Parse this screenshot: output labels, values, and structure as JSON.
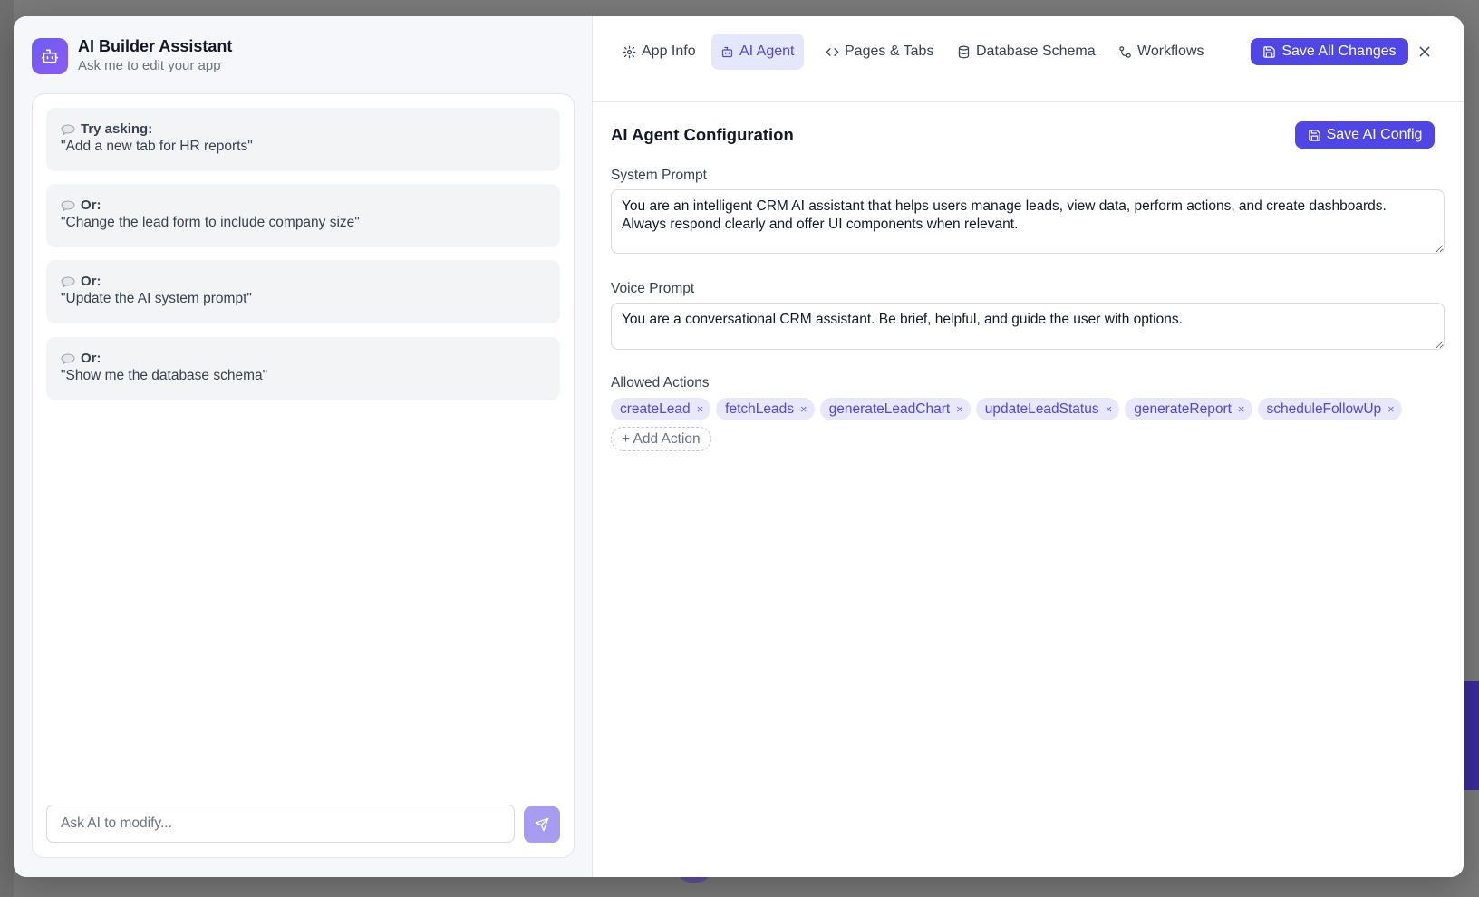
{
  "assistant": {
    "title": "AI Builder Assistant",
    "subtitle": "Ask me to edit your app"
  },
  "suggestions": [
    {
      "heading": "Try asking:",
      "text": "\"Add a new tab for HR reports\""
    },
    {
      "heading": "Or:",
      "text": "\"Change the lead form to include company size\""
    },
    {
      "heading": "Or:",
      "text": "\"Update the AI system prompt\""
    },
    {
      "heading": "Or:",
      "text": "\"Show me the database schema\""
    }
  ],
  "chat": {
    "placeholder": "Ask AI to modify..."
  },
  "tabs": [
    {
      "label": "App Info",
      "icon": "gear-icon"
    },
    {
      "label": "AI Agent",
      "icon": "bot-icon",
      "active": true
    },
    {
      "label": "Pages & Tabs",
      "icon": "code-icon"
    },
    {
      "label": "Database Schema",
      "icon": "database-icon"
    },
    {
      "label": "Workflows",
      "icon": "workflow-icon"
    }
  ],
  "header": {
    "save_all_label": "Save All Changes"
  },
  "agent": {
    "section_title": "AI Agent Configuration",
    "save_label": "Save AI Config",
    "system_prompt_label": "System Prompt",
    "system_prompt": "You are an intelligent CRM AI assistant that helps users manage leads, view data, perform actions, and create dashboards. Always respond clearly and offer UI components when relevant.",
    "voice_prompt_label": "Voice Prompt",
    "voice_prompt": "You are a conversational CRM assistant. Be brief, helpful, and guide the user with options.",
    "actions_label": "Allowed Actions",
    "actions": [
      "createLead",
      "fetchLeads",
      "generateLeadChart",
      "updateLeadStatus",
      "generateReport",
      "scheduleFollowUp"
    ],
    "add_action_label": "+ Add Action",
    "chip_remove_glyph": "×"
  },
  "colors": {
    "accent": "#4f46e5",
    "accent_soft": "#e5e7fb",
    "send_button": "#a79cf0"
  }
}
